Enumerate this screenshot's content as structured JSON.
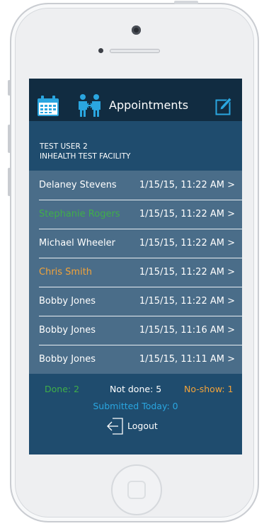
{
  "header": {
    "title": "Appointments"
  },
  "icons": {
    "calendar": "calendar-icon",
    "people": "people-icon",
    "compose": "compose-icon"
  },
  "user": {
    "name": "TEST USER 2",
    "facility": "INHEALTH TEST FACILITY"
  },
  "appointments": [
    {
      "name": "Delaney Stevens",
      "datetime": "1/15/15,  11:22 AM >",
      "status_color": "#ffffff"
    },
    {
      "name": "Stephanie Rogers",
      "datetime": "1/15/15,  11:22 AM >",
      "status_color": "#3fae49"
    },
    {
      "name": "Michael Wheeler",
      "datetime": "1/15/15,  11:22 AM >",
      "status_color": "#ffffff"
    },
    {
      "name": "Chris Smith",
      "datetime": "1/15/15,  11:22 AM >",
      "status_color": "#f2a33a"
    },
    {
      "name": "Bobby Jones",
      "datetime": "1/15/15,  11:22 AM >",
      "status_color": "#ffffff"
    },
    {
      "name": "Bobby Jones",
      "datetime": "1/15/15,  11:16 AM >",
      "status_color": "#ffffff"
    },
    {
      "name": "Bobby Jones",
      "datetime": "1/15/15,  11:11 AM >",
      "status_color": "#ffffff"
    }
  ],
  "summary": {
    "done": "Done: 2",
    "not_done": "Not done: 5",
    "no_show": "No-show: 1",
    "submitted_today": "Submitted Today: 0"
  },
  "logout_label": "Logout",
  "colors": {
    "done": "#3fae49",
    "not_done": "#ffffff",
    "no_show": "#f2a33a",
    "submitted": "#2aa6e0",
    "navbar": "#112c41",
    "background": "#1f4c6e",
    "list": "#4a6d89"
  }
}
